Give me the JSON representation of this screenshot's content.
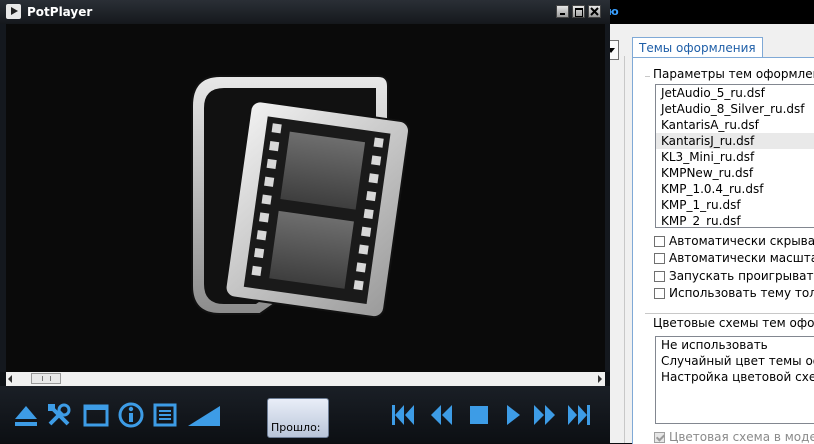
{
  "player": {
    "title": "PotPlayer",
    "time_label": "Прошло:"
  },
  "dialog": {
    "title_fragment": "ю",
    "tab_label": "Темы оформления",
    "themes_group_label": "Параметры тем оформления",
    "themes": [
      "JetAudio_5_ru.dsf",
      "JetAudio_8_Silver_ru.dsf",
      "KantarisA_ru.dsf",
      "KantarisJ_ru.dsf",
      "KL3_Mini_ru.dsf",
      "KMPNew_ru.dsf",
      "KMP_1.0.4_ru.dsf",
      "KMP_1_ru.dsf",
      "KMP_2_ru.dsf"
    ],
    "selected_theme": "KantarisJ_ru.dsf",
    "options": [
      "Автоматически скрывать",
      "Автоматически масштаби",
      "Запускать проигрыватель",
      "Использовать тему тольк"
    ],
    "colors_group_label": "Цветовые схемы тем оформ",
    "color_schemes": [
      "Не использовать",
      "Случайный цвет темы офо",
      "Настройка цветовой схемы"
    ],
    "bottom_option": "Цветовая схема в модели"
  },
  "colors": {
    "accent_blue": "#1f5fa8",
    "icon_blue": "#3d9ce6",
    "player_bg": "#0e1217"
  }
}
